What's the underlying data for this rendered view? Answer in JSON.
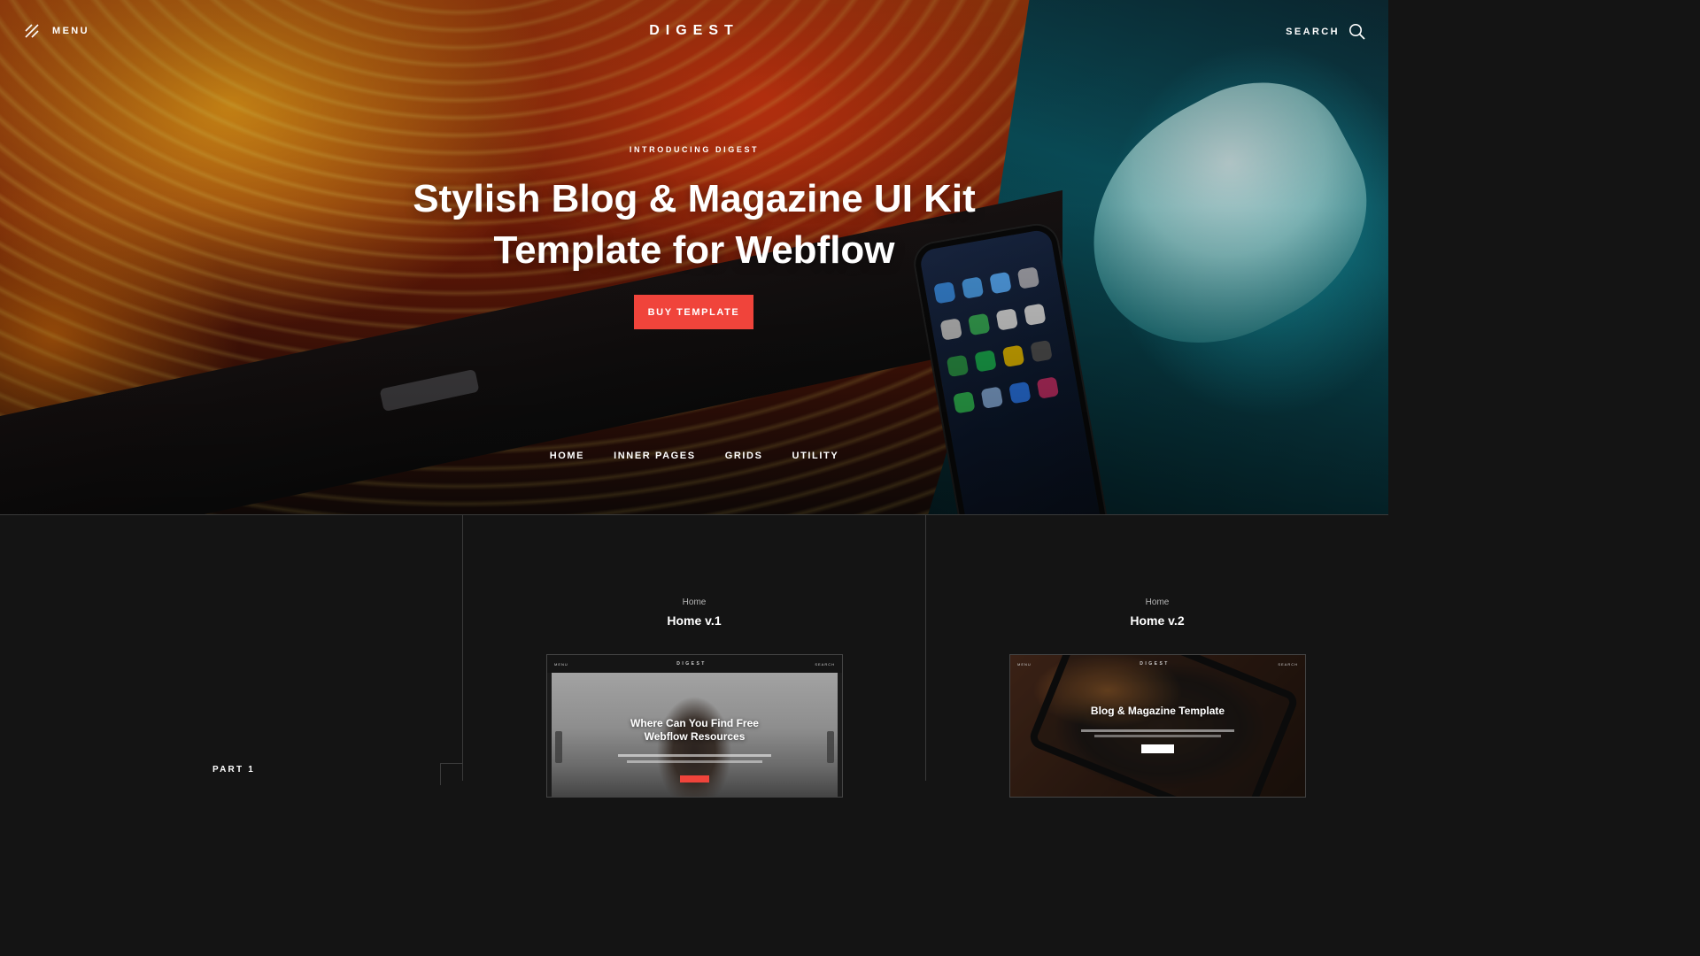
{
  "header": {
    "menu_label": "MENU",
    "brand": "DIGEST",
    "search_label": "SEARCH"
  },
  "hero": {
    "eyebrow": "INTRODUCING DIGEST",
    "title_line1": "Stylish Blog & Magazine UI Kit",
    "title_line2": "Template for Webflow",
    "cta_label": "BUY TEMPLATE",
    "cta_color": "#f0443b"
  },
  "subnav": {
    "items": [
      {
        "label": "HOME"
      },
      {
        "label": "INNER PAGES"
      },
      {
        "label": "GRIDS"
      },
      {
        "label": "UTILITY"
      }
    ]
  },
  "section": {
    "part_label": "PART 1"
  },
  "cards": [
    {
      "category": "Home",
      "title": "Home v.1",
      "preview": {
        "menu": "MENU",
        "brand": "DIGEST",
        "search": "SEARCH",
        "headline_line1": "Where Can You Find Free",
        "headline_line2": "Webflow Resources"
      }
    },
    {
      "category": "Home",
      "title": "Home v.2",
      "preview": {
        "menu": "MENU",
        "brand": "DIGEST",
        "search": "SEARCH",
        "headline_line1": "Blog & Magazine Template"
      }
    }
  ]
}
